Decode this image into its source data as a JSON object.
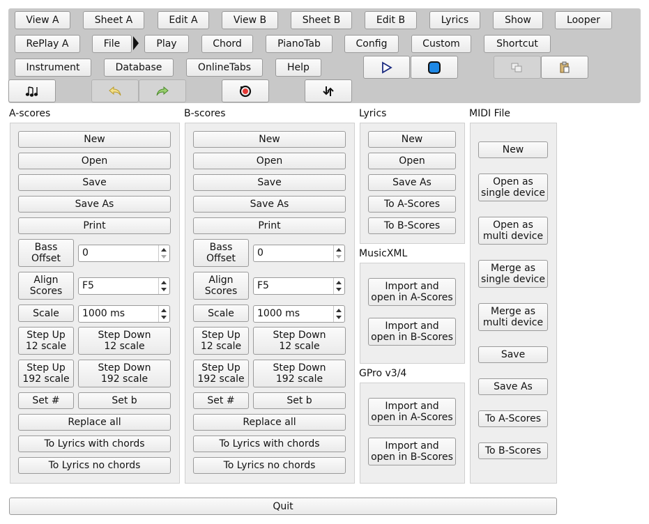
{
  "toolbar": {
    "row1": [
      "View A",
      "Sheet A",
      "Edit A",
      "View B",
      "Sheet B",
      "Edit B",
      "Lyrics",
      "Show",
      "Looper"
    ],
    "row2": [
      "RePlay A",
      "File",
      "Play",
      "Chord",
      "PianoTab",
      "Config",
      "Custom",
      "Shortcut"
    ],
    "row3": [
      "Instrument",
      "Database",
      "OnlineTabs",
      "Help"
    ],
    "icons": [
      "play-icon",
      "stop-icon",
      "copy-icon",
      "paste-icon",
      "notes-icon",
      "undo-icon",
      "redo-icon",
      "record-icon",
      "swap-icon"
    ]
  },
  "a_scores": {
    "title": "A-scores",
    "new": "New",
    "open": "Open",
    "save": "Save",
    "save_as": "Save As",
    "print": "Print",
    "bass_offset": "Bass\nOffset",
    "bass_offset_value": "0",
    "align_scores": "Align\nScores",
    "align_value": "F5",
    "scale": "Scale",
    "scale_value": "1000 ms",
    "step_up_12": "Step Up\n12 scale",
    "step_down_12": "Step Down\n12 scale",
    "step_up_192": "Step Up\n192 scale",
    "step_down_192": "Step Down\n192 scale",
    "set_sharp": "Set #",
    "set_flat": "Set b",
    "replace_all": "Replace all",
    "to_lyrics_chords": "To Lyrics with chords",
    "to_lyrics_no_chords": "To Lyrics no chords"
  },
  "b_scores": {
    "title": "B-scores",
    "new": "New",
    "open": "Open",
    "save": "Save",
    "save_as": "Save As",
    "print": "Print",
    "bass_offset": "Bass\nOffset",
    "bass_offset_value": "0",
    "align_scores": "Align\nScores",
    "align_value": "F5",
    "scale": "Scale",
    "scale_value": "1000 ms",
    "step_up_12": "Step Up\n12 scale",
    "step_down_12": "Step Down\n12 scale",
    "step_up_192": "Step Up\n192 scale",
    "step_down_192": "Step Down\n192 scale",
    "set_sharp": "Set #",
    "set_flat": "Set b",
    "replace_all": "Replace all",
    "to_lyrics_chords": "To Lyrics with chords",
    "to_lyrics_no_chords": "To Lyrics no chords"
  },
  "lyrics": {
    "title": "Lyrics",
    "new": "New",
    "open": "Open",
    "save_as": "Save As",
    "to_a": "To A-Scores",
    "to_b": "To B-Scores"
  },
  "musicxml": {
    "title": "MusicXML",
    "import_a": "Import and\nopen in A-Scores",
    "import_b": "Import and\nopen in B-Scores"
  },
  "gpro": {
    "title": "GPro v3/4",
    "import_a": "Import and\nopen in A-Scores",
    "import_b": "Import and\nopen in B-Scores"
  },
  "midi": {
    "title": "MIDI File",
    "new": "New",
    "open_single": "Open as\nsingle device",
    "open_multi": "Open as\nmulti device",
    "merge_single": "Merge as\nsingle device",
    "merge_multi": "Merge as\nmulti device",
    "save": "Save",
    "save_as": "Save As",
    "to_a": "To A-Scores",
    "to_b": "To B-Scores"
  },
  "quit": "Quit"
}
